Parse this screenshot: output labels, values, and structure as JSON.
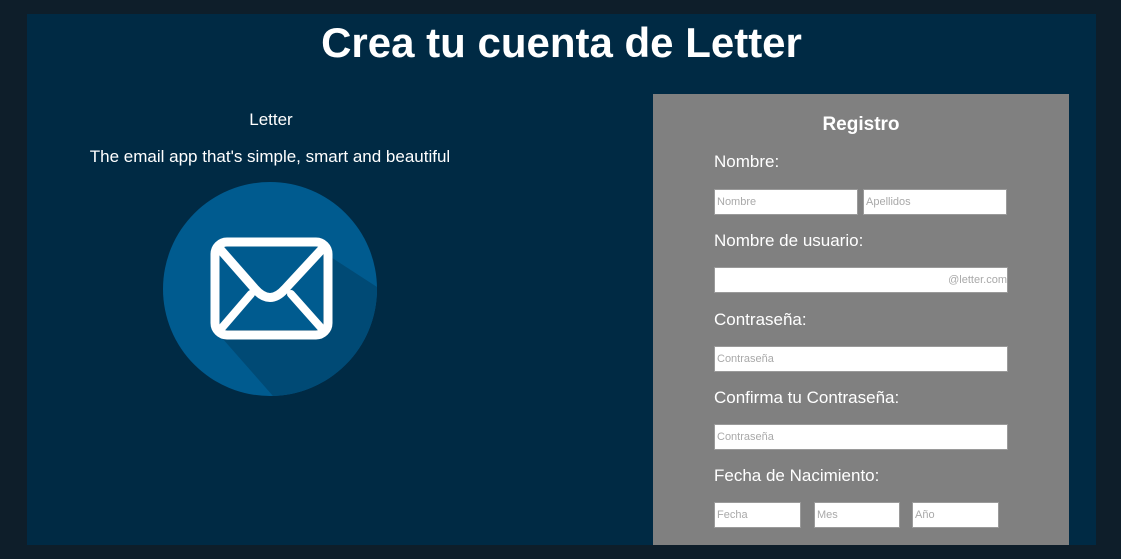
{
  "header": {
    "title": "Crea tu cuenta de Letter"
  },
  "intro": {
    "brand": "Letter",
    "tagline": "The email app that's simple, smart and beautiful",
    "logo_icon": "envelope-icon"
  },
  "colors": {
    "page_background": "#002a44",
    "outer_background": "#0e1e2a",
    "panel_background": "#808080",
    "logo_circle": "#005b8f",
    "logo_shadow": "#004a75"
  },
  "form": {
    "title": "Registro",
    "name": {
      "label": "Nombre:",
      "first_placeholder": "Nombre",
      "last_placeholder": "Apellidos"
    },
    "username": {
      "label": "Nombre de usuario:",
      "value": "",
      "suffix": "@letter.com"
    },
    "password": {
      "label": "Contraseña:",
      "placeholder": "Contraseña"
    },
    "confirm_password": {
      "label": "Confirma tu Contraseña:",
      "placeholder": "Contraseña"
    },
    "birthdate": {
      "label": "Fecha de Nacimiento:",
      "day_placeholder": "Fecha",
      "month_placeholder": "Mes",
      "year_placeholder": "Año"
    }
  }
}
